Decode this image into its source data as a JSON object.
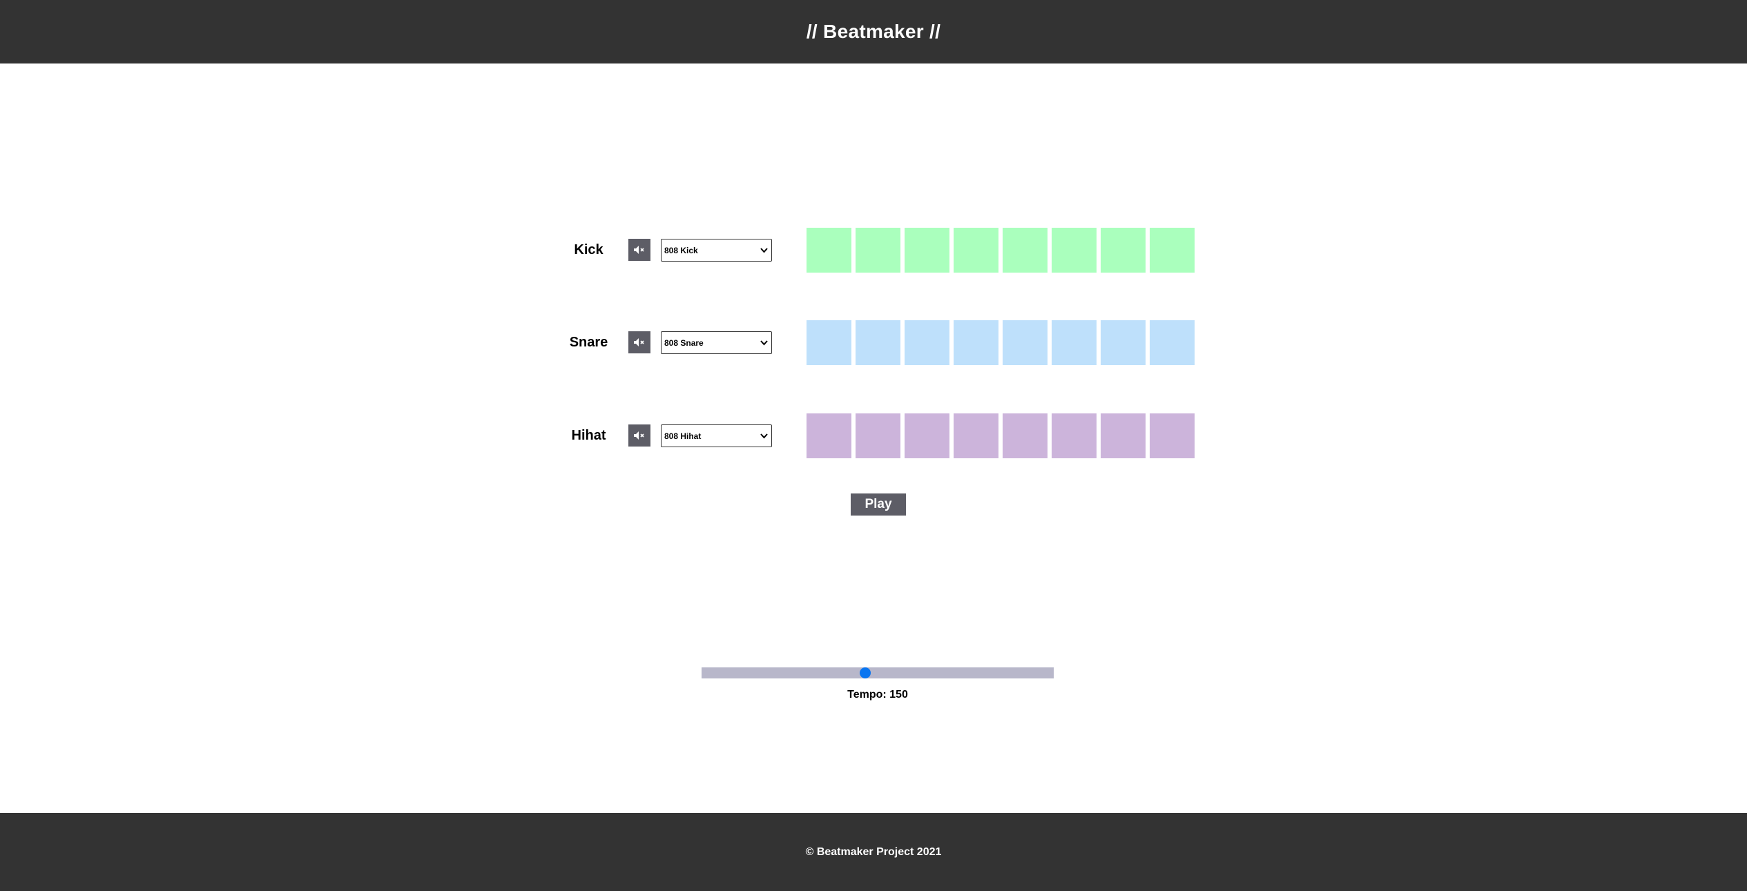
{
  "header": {
    "title": "// Beatmaker //"
  },
  "tracks": [
    {
      "name": "Kick",
      "selected_sound": "808 Kick",
      "pad_color": "#aaffbd",
      "pads": 8
    },
    {
      "name": "Snare",
      "selected_sound": "808 Snare",
      "pad_color": "#bee0fb",
      "pads": 8
    },
    {
      "name": "Hihat",
      "selected_sound": "808 Hihat",
      "pad_color": "#ccb4db",
      "pads": 8
    }
  ],
  "controls": {
    "play_label": "Play",
    "mute_icon": "mute-speaker-icon",
    "select_icon": "chevron-down-icon"
  },
  "tempo": {
    "label": "Tempo: 150",
    "value": 150,
    "slider_fraction": 0.465
  },
  "footer": {
    "text": "© Beatmaker Project 2021"
  },
  "colors": {
    "bar": "#333333",
    "button": "#5d5d66",
    "slider_track": "#b8b7ca",
    "slider_thumb": "#0a75f0"
  }
}
